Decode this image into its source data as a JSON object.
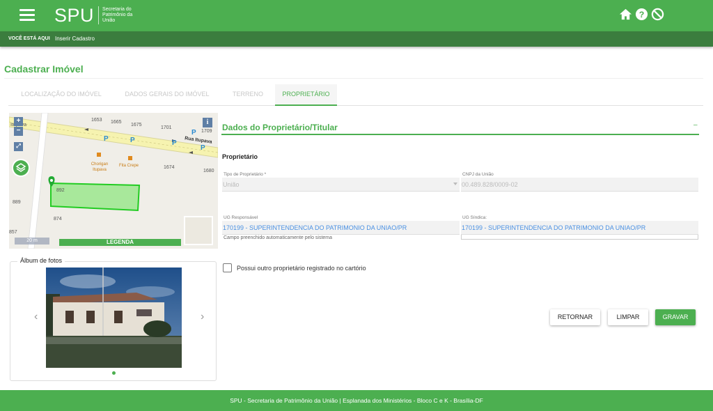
{
  "header": {
    "logo_text": "SPU",
    "logo_subtitle": "Secretaria do Patrimônio da União",
    "icons": [
      "menu-icon",
      "home-icon",
      "help-icon",
      "block-icon"
    ]
  },
  "breadcrumb": {
    "label": "VOCÊ ESTÁ AQUI",
    "current": "Inserir Cadastro"
  },
  "page": {
    "title": "Cadastrar Imóvel"
  },
  "tabs": [
    {
      "label": "LOCALIZAÇÃO DO IMÓVEL",
      "active": false
    },
    {
      "label": "DADOS GERAIS DO IMÓVEL",
      "active": false
    },
    {
      "label": "TERRENO",
      "active": false
    },
    {
      "label": "PROPRIETÁRIO",
      "active": true
    }
  ],
  "map": {
    "zoom_in": "+",
    "zoom_out": "−",
    "info": "i",
    "legend": "LEGENDA",
    "scale": "20 m",
    "street": "Rua Itupava",
    "street_left": "Itupava",
    "mini_label": "",
    "numbers": [
      "1653",
      "1665",
      "1675",
      "1701",
      "1709",
      "1674",
      "1680",
      "892",
      "889",
      "874",
      "857"
    ],
    "pois": [
      "Chorigan Itupava",
      "Fita Crepe"
    ],
    "parking": "P"
  },
  "album": {
    "legend": "Álbum de fotos",
    "prev": "‹",
    "next": "›"
  },
  "section": {
    "title": "Dados do Proprietário/Titular",
    "collapse": "–",
    "subtitle": "Proprietário"
  },
  "form": {
    "tipo_label": "Tipo de Proprietário *",
    "tipo_value": "União",
    "cnpj_label": "CNPJ da União",
    "cnpj_value": "00.489.828/0009-02",
    "ug_resp_label": "UG Responsável",
    "ug_resp_value": "170199 - SUPERINTENDENCIA DO PATRIMONIO DA UNIAO/PR",
    "ug_resp_hint": "Campo preenchido automaticamente pelo sistema",
    "ug_sind_label": "UG Síndica:",
    "ug_sind_value": "170199 - SUPERINTENDENCIA DO PATRIMONIO DA UNIAO/PR",
    "checkbox_label": "Possui outro proprietário registrado no cartório"
  },
  "buttons": {
    "back": "RETORNAR",
    "clear": "LIMPAR",
    "save": "GRAVAR"
  },
  "footer": {
    "text": "SPU - Secretaria de Patrimônio da União | Esplanada dos Ministérios - Bloco C e K - Brasília-DF"
  },
  "colors": {
    "primary": "#4caf50",
    "dark_green": "#3b7d3e",
    "link_blue": "#4a90e2"
  }
}
